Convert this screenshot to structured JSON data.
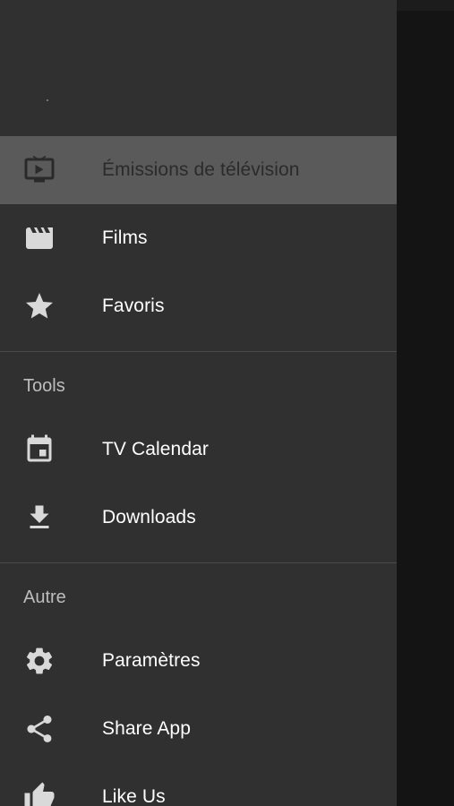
{
  "drawer": {
    "items": [
      {
        "label": "Émissions de télévision",
        "icon": "tv-icon",
        "selected": true
      },
      {
        "label": "Films",
        "icon": "movie-clapper-icon"
      },
      {
        "label": "Favoris",
        "icon": "star-icon"
      }
    ],
    "sections": [
      {
        "title": "Tools",
        "items": [
          {
            "label": "TV Calendar",
            "icon": "calendar-icon"
          },
          {
            "label": "Downloads",
            "icon": "download-icon"
          }
        ]
      },
      {
        "title": "Autre",
        "items": [
          {
            "label": "Paramètres",
            "icon": "settings-gear-icon"
          },
          {
            "label": "Share App",
            "icon": "share-icon"
          },
          {
            "label": "Like Us",
            "icon": "thumbs-up-icon"
          }
        ]
      }
    ]
  },
  "colors": {
    "drawer_bg": "#303030",
    "selected_bg": "#5a5a5a",
    "scrim": "#141414"
  }
}
